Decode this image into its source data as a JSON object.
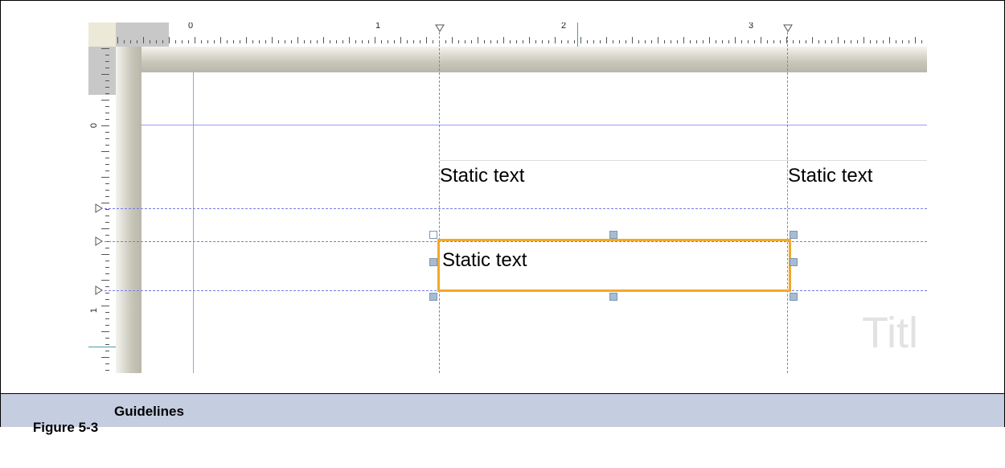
{
  "figure": {
    "number": "Figure 5-3",
    "title": "Guidelines"
  },
  "horizontal_ruler": {
    "labels": [
      "0",
      "1",
      "2",
      "3"
    ]
  },
  "vertical_ruler": {
    "labels": [
      "0",
      "1"
    ]
  },
  "canvas": {
    "text_items": [
      "Static text",
      "Static text",
      "Static text"
    ],
    "selected_item": "Static text",
    "faint_title": "Titl"
  },
  "colors": {
    "guideline": "#7a7ae8",
    "selection": "#f3a82a",
    "handle": "#a7bcd0",
    "caption_bar": "#c5cde0"
  },
  "icons": {
    "ruler_guide_marker": "triangle-guide-marker-icon",
    "selection_handle": "square-handle-icon"
  }
}
